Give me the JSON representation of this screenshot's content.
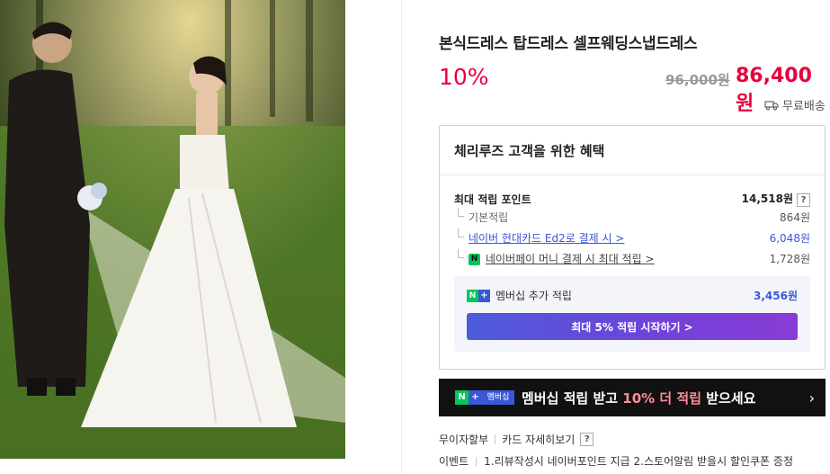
{
  "product": {
    "title": "본식드레스 탑드레스 셀프웨딩스냅드레스",
    "discount": "10%",
    "original_price": "96,000원",
    "sale_price": "86,400원",
    "delivery": "무료배송",
    "image_alt": "wedding couple photo"
  },
  "benefits": {
    "title": "체리루즈 고객을 위한 혜택",
    "max_points_label": "최대 적립 포인트",
    "max_points_value": "14,518원",
    "help": "?",
    "rows": [
      {
        "label": "기본적립",
        "value": "864원"
      },
      {
        "label": "네이버 현대카드 Ed2로 결제 시 >",
        "value": "6,048원"
      },
      {
        "label": "네이버페이 머니 결제 시 최대 적립 >",
        "value": "1,728원"
      }
    ],
    "npay_badge": "N",
    "membership": {
      "label": "멤버십 추가 적립",
      "value": "3,456원",
      "button": "최대 5% 적립 시작하기 >"
    }
  },
  "banner": {
    "tag_n": "N",
    "tag_plus": "+",
    "tag_text": "멤버십",
    "text_before": "멤버십 적립 받고 ",
    "text_highlight": "10% 더 적립",
    "text_after": " 받으세요",
    "chevron": "›"
  },
  "installment": {
    "label": "무이자할부",
    "link": "카드 자세히보기",
    "help": "?"
  },
  "event": {
    "label": "이벤트",
    "text": "1.리뷰작성시 네이버포인트 지급 2.스토어알림 받을시 할인쿠폰 증정"
  },
  "colors": {
    "accent_red": "#e8003d",
    "naver_green": "#03c75a",
    "link_blue": "#3b57d8"
  }
}
